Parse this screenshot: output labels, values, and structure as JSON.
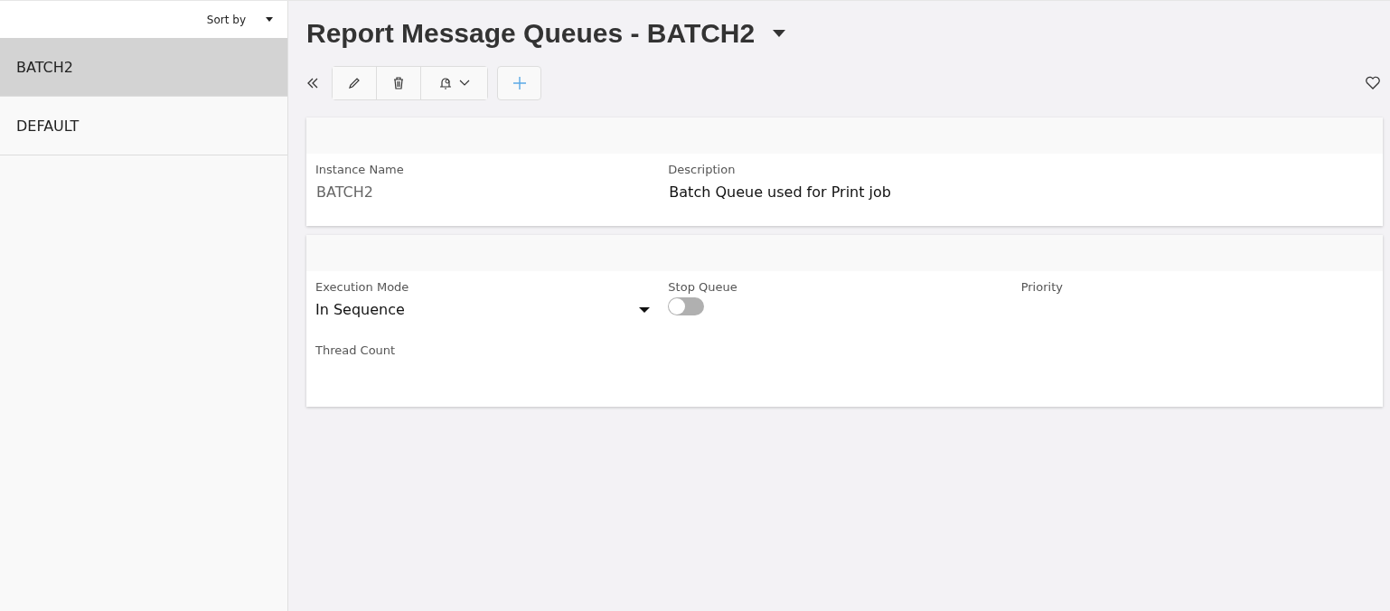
{
  "sidebar": {
    "sort_label": "Sort by",
    "items": [
      {
        "label": "BATCH2",
        "selected": true
      },
      {
        "label": "DEFAULT",
        "selected": false
      }
    ]
  },
  "page": {
    "title": "Report Message Queues - BATCH2"
  },
  "cards": [
    {
      "fields": [
        {
          "kind": "readonly",
          "label": "Instance Name",
          "value": "BATCH2"
        },
        {
          "kind": "text",
          "label": "Description",
          "value": "Batch Queue used for Print job"
        }
      ]
    },
    {
      "fields": [
        {
          "kind": "select",
          "label": "Execution Mode",
          "value": "In Sequence"
        },
        {
          "kind": "toggle",
          "label": "Stop Queue",
          "on": false
        },
        {
          "kind": "empty",
          "label": "Priority"
        },
        {
          "kind": "empty",
          "label": "Thread Count"
        }
      ]
    }
  ]
}
